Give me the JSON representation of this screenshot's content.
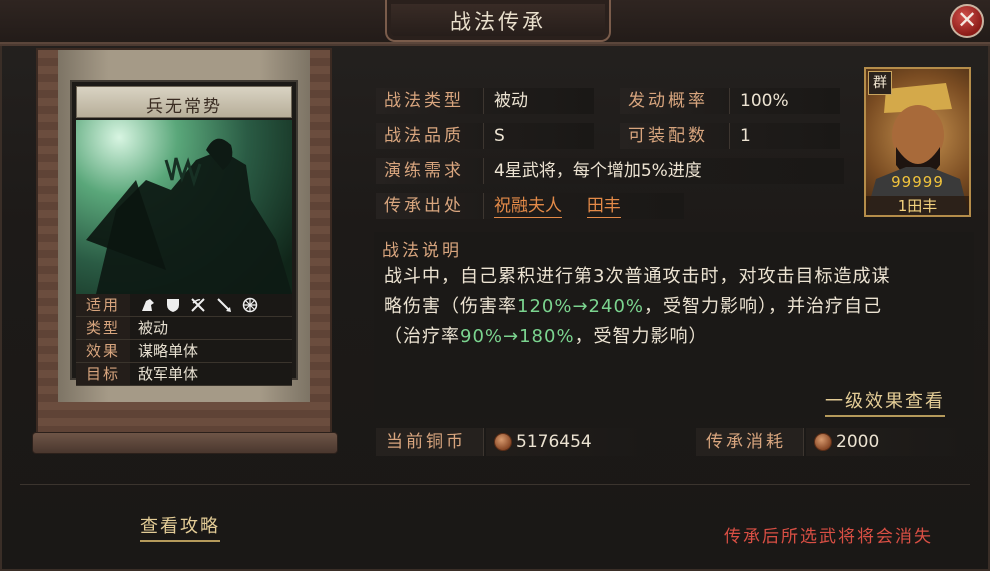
{
  "window": {
    "title": "战法传承",
    "close_glyph": "✕"
  },
  "card": {
    "name": "兵无常势",
    "rows": [
      {
        "label": "适用",
        "value": ""
      },
      {
        "label": "类型",
        "value": "被动"
      },
      {
        "label": "效果",
        "value": "谋略单体"
      },
      {
        "label": "目标",
        "value": "敌军单体"
      }
    ],
    "applicable_icons": [
      "cavalry-icon",
      "shield-icon",
      "bow-icon",
      "spear-icon",
      "chariot-wheel-icon"
    ]
  },
  "info": {
    "type_label": "战法类型",
    "type_value": "被动",
    "chance_label": "发动概率",
    "chance_value": "100%",
    "quality_label": "战法品质",
    "quality_value": "S",
    "equip_label": "可装配数",
    "equip_value": "1",
    "req_label": "演练需求",
    "req_value": "4星武将，每个增加5%进度",
    "source_label": "传承出处",
    "source_1": "祝融夫人",
    "source_2": "田丰"
  },
  "description": {
    "title": "战法说明",
    "line1": "战斗中，自己累积进行第3次普通攻击时，对攻击目标造成谋",
    "line2_a": "略伤害（伤害率",
    "line2_green": "120%→240%",
    "line2_b": "，受智力影响），并治疗自己",
    "line3_a": "（治疗率",
    "line3_green": "90%→180%",
    "line3_b": "，受智力影响）"
  },
  "links": {
    "effect_view": "一级效果查看",
    "guide": "查看攻略"
  },
  "cost": {
    "copper_label": "当前铜币",
    "copper_value": "5176454",
    "consume_label": "传承消耗",
    "consume_value": "2000"
  },
  "warning": "传承后所选武将将会消失",
  "portrait": {
    "faction": "群",
    "stars": "99999",
    "name": "1田丰"
  },
  "colors": {
    "accent_orange": "#e38a48",
    "label_tan": "#d8a57e",
    "green": "#7bd48f",
    "warning_red": "#d94f44"
  }
}
